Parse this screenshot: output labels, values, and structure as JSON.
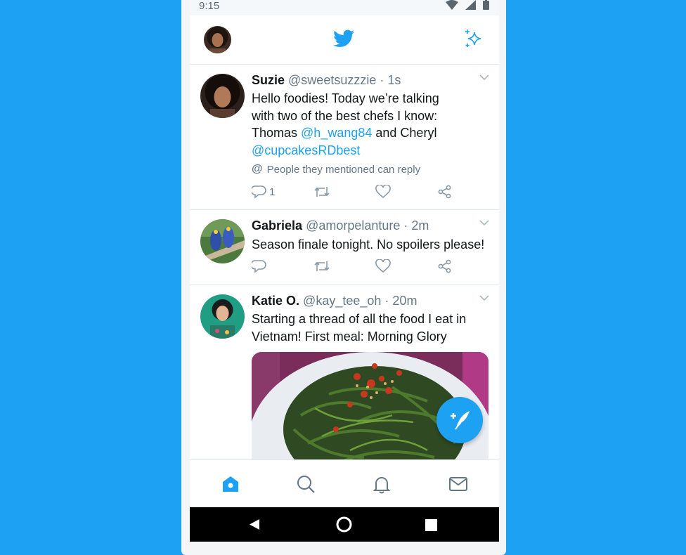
{
  "status_bar": {
    "time": "9:15"
  },
  "tweets": [
    {
      "name": "Suzie",
      "handle": "@sweetsuzzzie",
      "time": "· 1s",
      "text_a": "Hello foodies! Today we’re talking",
      "text_b": "with two of the best chefs I know:",
      "text_c1": "Thomas ",
      "mention_1": "@h_wang84",
      "text_c2": " and Cheryl",
      "mention_2": "@cupcakesRDbest",
      "reply_note": "People they mentioned can reply",
      "reply_count": "1"
    },
    {
      "name": "Gabriela",
      "handle": "@amorpelanture",
      "time": "· 2m",
      "text": "Season finale tonight. No spoilers please!"
    },
    {
      "name": "Katie O.",
      "handle": "@kay_tee_oh",
      "time": "· 20m",
      "text_a": "Starting a thread of all the food I eat in",
      "text_b": "Vietnam! First meal: Morning Glory"
    }
  ],
  "icons": {
    "brand_color": "#1da1f2",
    "app": [
      "twitter-bird-icon",
      "sparkle-icon"
    ],
    "actions": [
      "reply-icon",
      "retweet-icon",
      "like-icon",
      "share-icon"
    ],
    "tabs": [
      "home-icon",
      "search-icon",
      "notifications-icon",
      "messages-icon"
    ],
    "nav": [
      "back-icon",
      "home-circle-icon",
      "recents-icon"
    ]
  }
}
